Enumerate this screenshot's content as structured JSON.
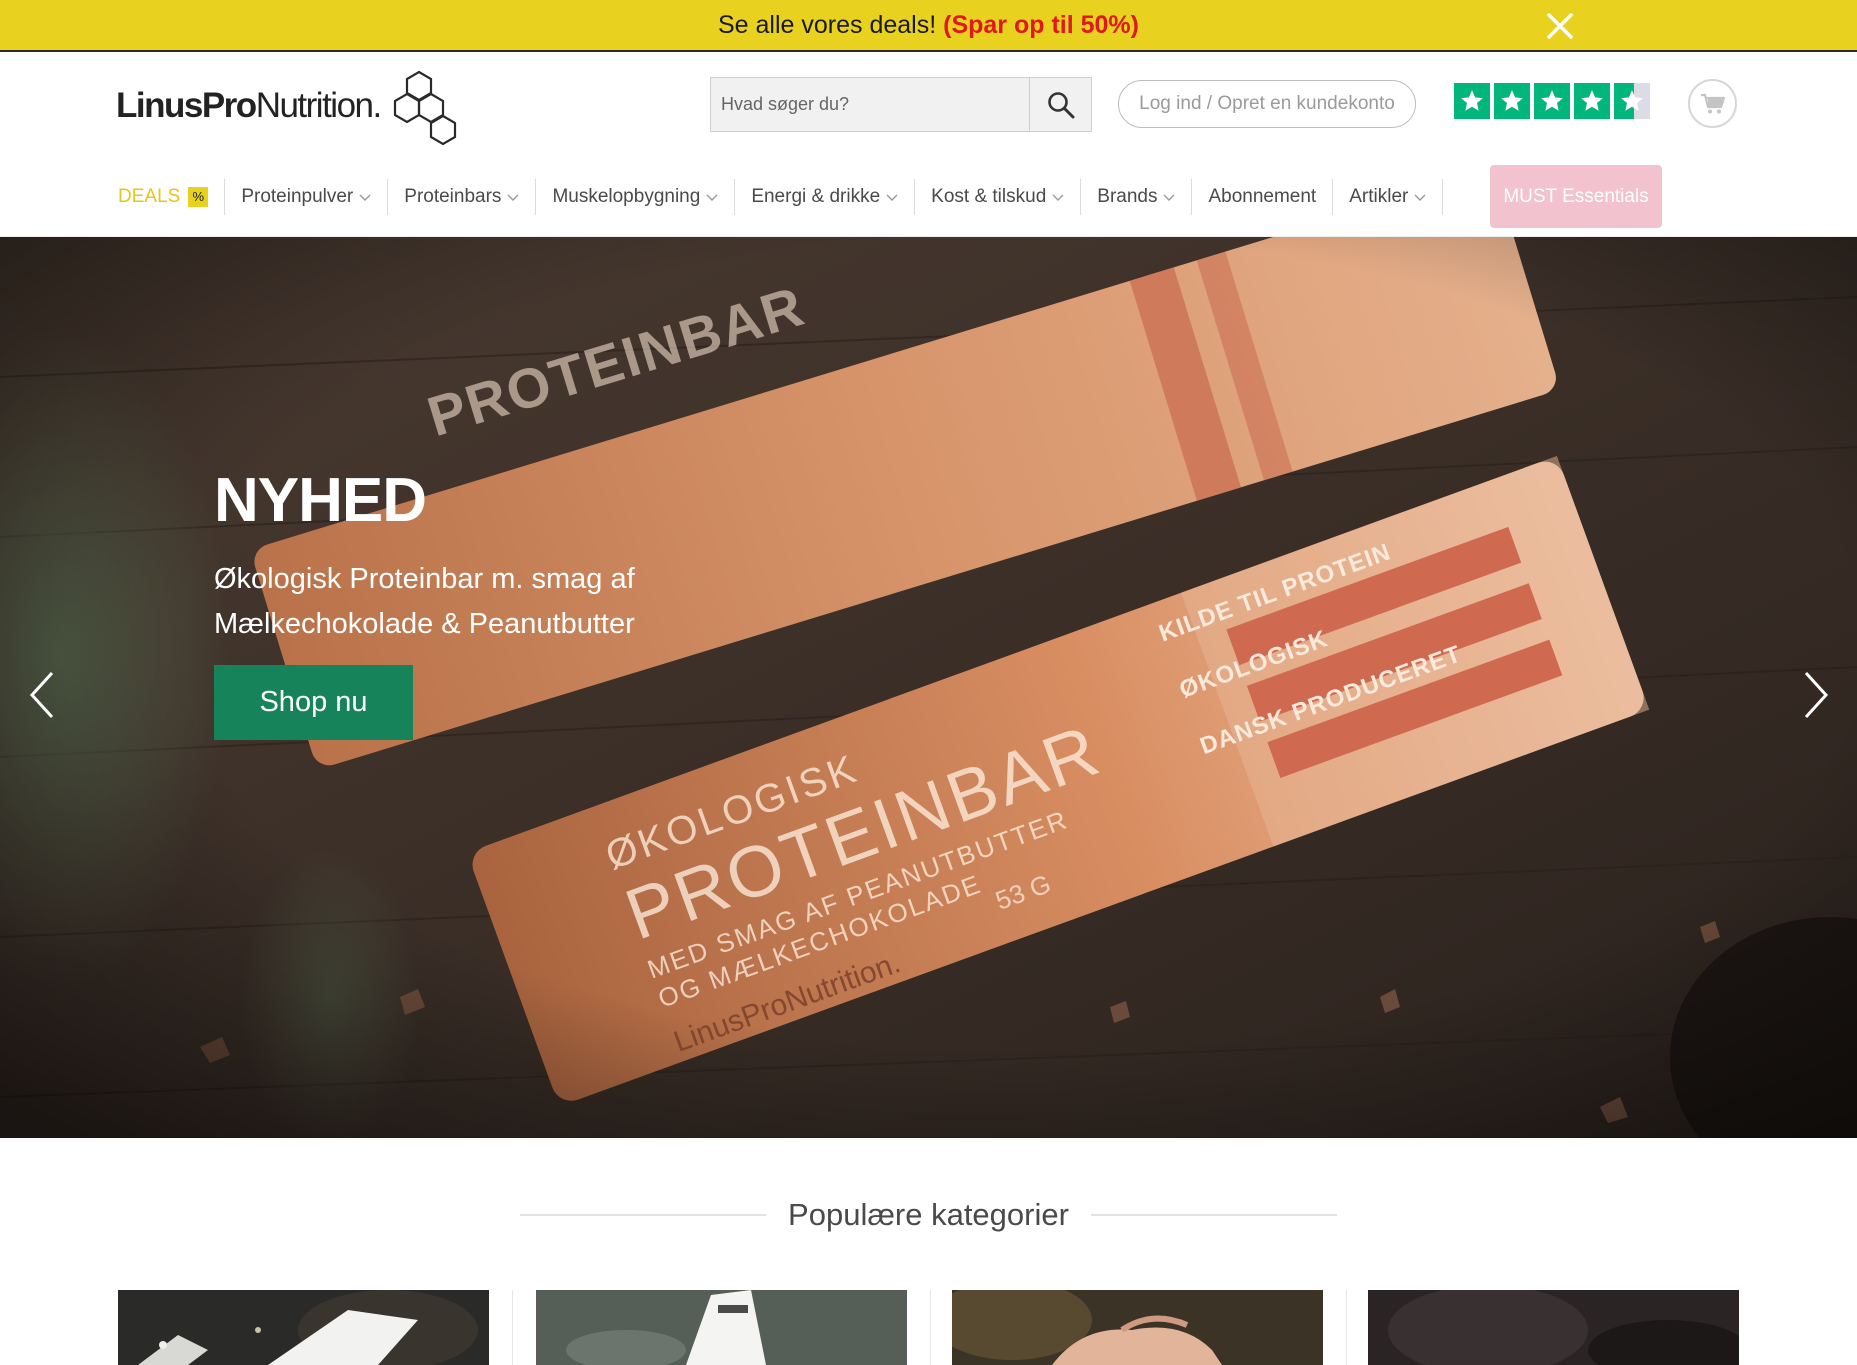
{
  "promo": {
    "text": "Se alle vores deals!",
    "highlight": "(Spar op til 50%)"
  },
  "header": {
    "logo_bold": "LinusPro",
    "logo_light": "Nutrition",
    "logo_registered": ".",
    "search_placeholder": "Hvad søger du?",
    "login_label": "Log ind / Opret en kundekonto",
    "trustpilot_rating": 4.5
  },
  "nav": {
    "items": [
      {
        "label": "DEALS",
        "badge": "%"
      },
      {
        "label": "Proteinpulver"
      },
      {
        "label": "Proteinbars"
      },
      {
        "label": "Muskelopbygning"
      },
      {
        "label": "Energi & drikke"
      },
      {
        "label": "Kost & tilskud"
      },
      {
        "label": "Brands"
      },
      {
        "label": "Abonnement"
      },
      {
        "label": "Artikler"
      }
    ],
    "must_label": "MUST Essentials"
  },
  "hero": {
    "title": "NYHED",
    "subtitle": "Økologisk Proteinbar m. smag af Mælkechokolade & Peanutbutter",
    "cta_label": "Shop nu",
    "wrapper": {
      "top_text": "ØKOLOGISK",
      "main_text": "PROTEINBAR",
      "flavor_line1": "MED SMAG AF PEANUTBUTTER",
      "flavor_line2": "OG MÆLKECHOKOLADE",
      "weight": "53 G",
      "brand": "LinusProNutrition.",
      "tag1": "KILDE TIL PROTEIN",
      "tag2": "ØKOLOGISK",
      "tag3": "DANSK PRODUCERET"
    }
  },
  "categories": {
    "title": "Populære kategorier"
  },
  "colors": {
    "promo_bg": "#e8d21f",
    "promo_highlight": "#e0191f",
    "cta_green": "#17835a",
    "trustpilot_green": "#00b67a",
    "must_pink": "#f2c3cf",
    "deals_yellow": "#e8c41a"
  }
}
